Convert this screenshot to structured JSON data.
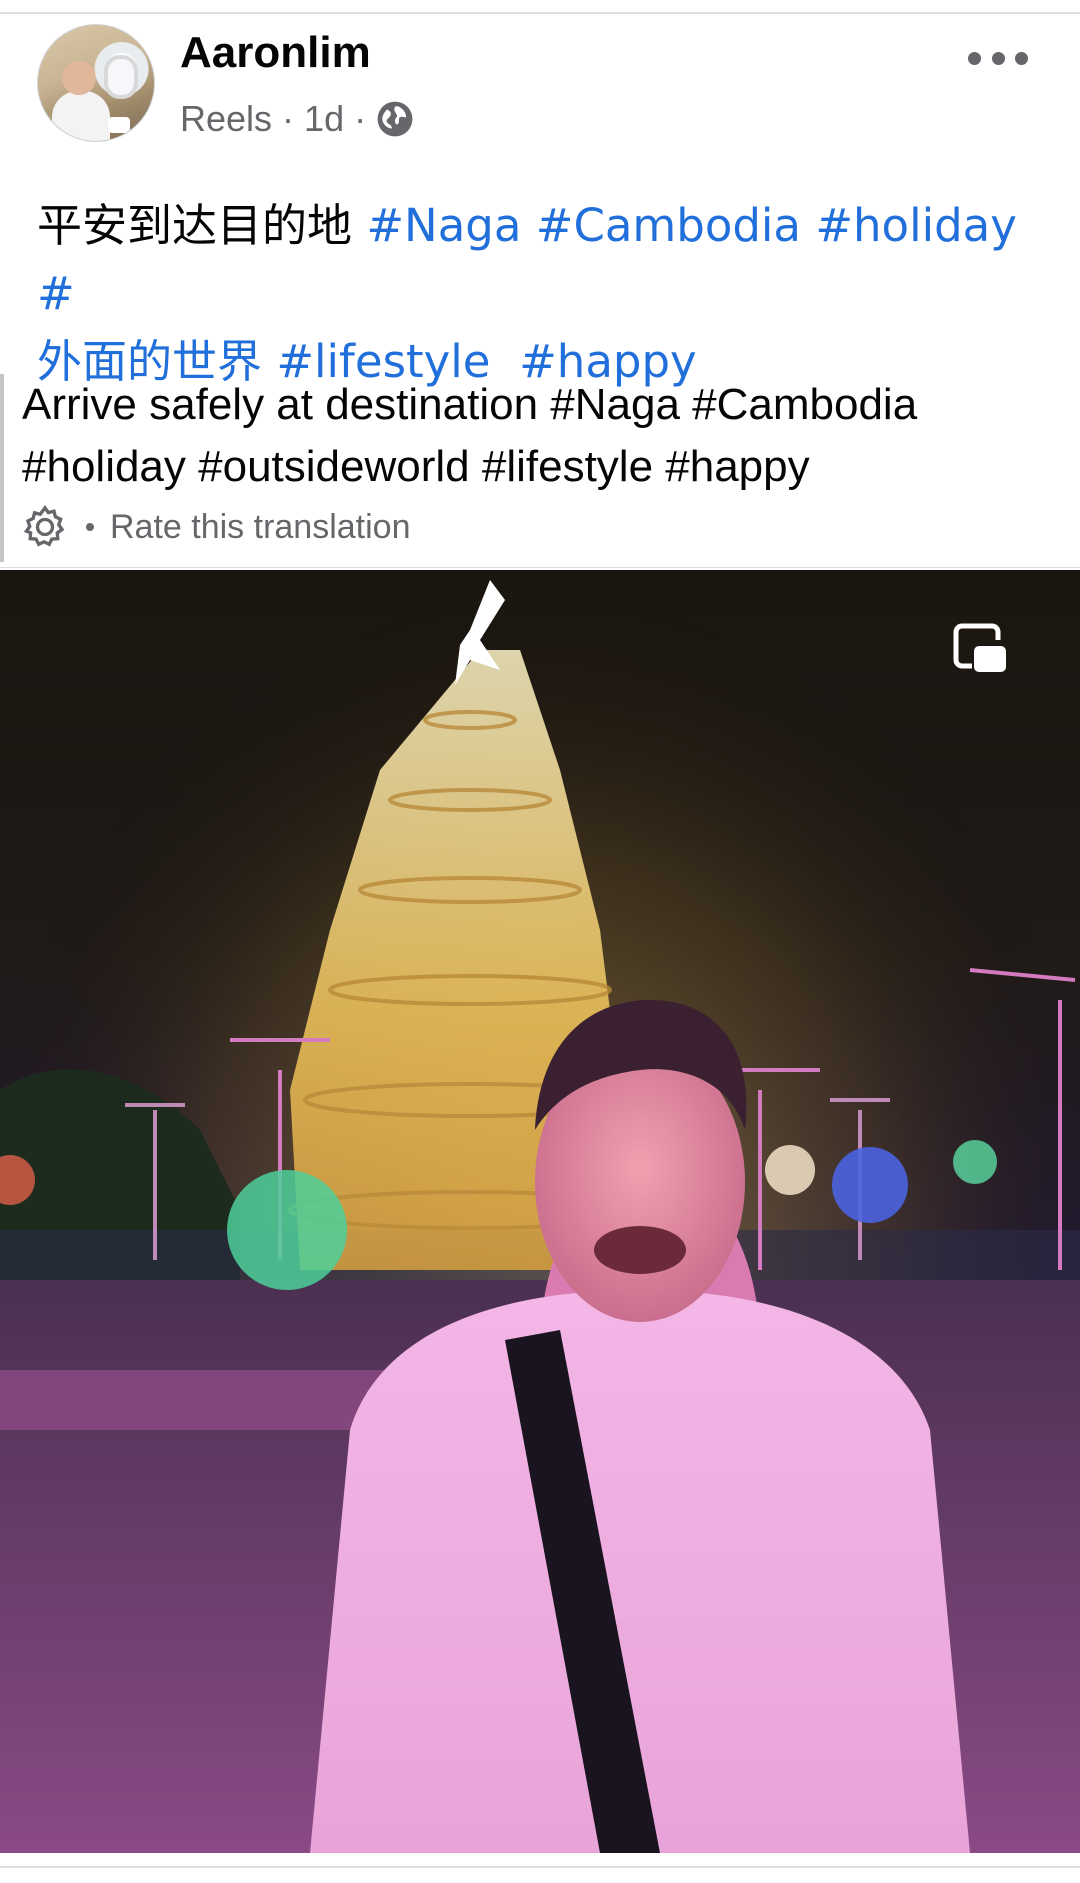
{
  "post": {
    "author": "Aaronlim",
    "meta": {
      "source": "Reels",
      "separator": "·",
      "time": "1d"
    },
    "caption": {
      "text": "平安到达目的地",
      "tag1": "#Naga",
      "tag2": "#Cambodia",
      "tag3": "#holiday",
      "tag4": "#",
      "tag5": "外面的世界",
      "tag6": "#lifestyle",
      "tag7": "#happy"
    },
    "translation": {
      "line1": "Arrive safely at destination #Naga #Cambodia",
      "line2": "#holiday #outsideworld #lifestyle #happy",
      "rate_label": "Rate this translation"
    }
  },
  "icons": {
    "globe": "globe-icon",
    "more": "more-horizontal-icon",
    "gear": "gear-icon",
    "pip": "picture-in-picture-icon"
  },
  "colors": {
    "hashtag": "#216fdb",
    "secondary_text": "#65676b"
  }
}
